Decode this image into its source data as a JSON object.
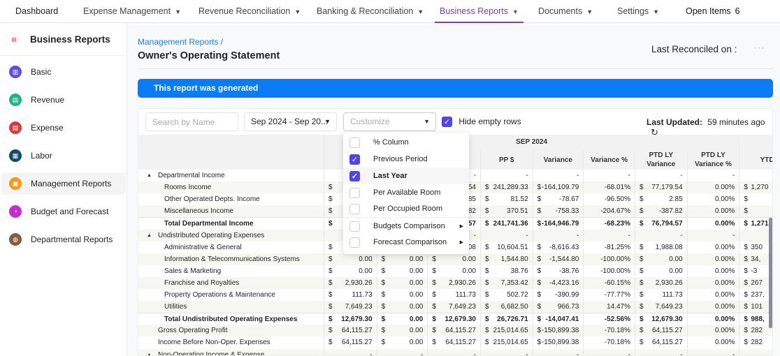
{
  "nav": {
    "items": [
      {
        "label": "Dashboard",
        "caret": false
      },
      {
        "label": "Expense Management",
        "caret": true
      },
      {
        "label": "Revenue Reconciliation",
        "caret": true
      },
      {
        "label": "Banking & Reconciliation",
        "caret": true
      },
      {
        "label": "Business Reports",
        "caret": true,
        "active": true
      },
      {
        "label": "Documents",
        "caret": true
      },
      {
        "label": "Settings",
        "caret": true
      }
    ],
    "open_items_label": "Open Items",
    "open_items_count": "6",
    "accent": "#7a3fb0"
  },
  "sidebar": {
    "title": "Business Reports",
    "items": [
      {
        "label": "Basic",
        "color": "#5b4ee8",
        "icon": "chart-icon"
      },
      {
        "label": "Revenue",
        "color": "#1fb58a",
        "icon": "revenue-icon"
      },
      {
        "label": "Expense",
        "color": "#d63b3b",
        "icon": "expense-icon"
      },
      {
        "label": "Labor",
        "color": "#0f4c6e",
        "icon": "labor-icon"
      },
      {
        "label": "Management Reports",
        "color": "#f29a17",
        "icon": "report-icon",
        "active": true
      },
      {
        "label": "Budget and Forecast",
        "color": "#c52ec9",
        "icon": "pie-chart-icon"
      },
      {
        "label": "Departmental Reports",
        "color": "#8a5a3c",
        "icon": "department-icon"
      }
    ]
  },
  "page": {
    "breadcrumb": "Management Reports /",
    "title": "Owner's Operating Statement",
    "last_reconciled": "Last Reconciled on :",
    "more": "···",
    "banner": "This report was generated",
    "banner_color": "#0a7cf5"
  },
  "toolbar": {
    "search_placeholder": "Search by Name",
    "period": "Sep 2024 - Sep 20...",
    "customize_placeholder": "Customize",
    "hide_empty_label": "Hide empty rows",
    "hide_empty_checked": true,
    "last_updated_label": "Last Updated:",
    "last_updated_value": "59 minutes ago"
  },
  "customize_menu": [
    {
      "label": "% Column",
      "checked": false
    },
    {
      "label": "Previous Period",
      "checked": true
    },
    {
      "label": "Last Year",
      "checked": true,
      "highlighted": true
    },
    {
      "label": "Per Available Room",
      "checked": false
    },
    {
      "label": "Per Occupied Room",
      "checked": false
    },
    {
      "label": "Budgets Comparison",
      "checked": false,
      "submenu": true
    },
    {
      "label": "Forecast Comparison",
      "checked": false,
      "submenu": true
    }
  ],
  "table": {
    "group_header": "SEP 2024",
    "columns": [
      "",
      "",
      "",
      "PP $",
      "Variance",
      "Variance %",
      "PTD LY Variance",
      "PTD LY Variance %",
      "YTD"
    ],
    "rows": [
      {
        "label": "Departmental Income",
        "type": "section",
        "cells": [
          "-",
          "-",
          "-",
          "-",
          "-",
          "-",
          "-",
          "-",
          ""
        ]
      },
      {
        "label": "Rooms Income",
        "cells": [
          "",
          "",
          "54",
          "241,289.33",
          "-164,109.79",
          "-68.01%",
          "77,179.54",
          "0.00%",
          "1,270"
        ]
      },
      {
        "label": "Other Operated Depts. Income",
        "cells": [
          "",
          "",
          "85",
          "81.52",
          "-78.67",
          "-96.50%",
          "2.85",
          "0.00%",
          ""
        ]
      },
      {
        "label": "Miscellaneous Income",
        "cells": [
          "",
          "",
          "82",
          "370.51",
          "-758.33",
          "-204.67%",
          "-387.82",
          "0.00%",
          ""
        ]
      },
      {
        "label": "Total Departmental Income",
        "type": "total",
        "cells": [
          "",
          "",
          "57",
          "241,741.36",
          "-164,946.79",
          "-68.23%",
          "76,794.57",
          "0.00%",
          "1,271,"
        ]
      },
      {
        "label": "Undistributed Operating Expenses",
        "type": "section",
        "cells": [
          "-",
          "-",
          "-",
          "-",
          "-",
          "-",
          "-",
          "-",
          ""
        ]
      },
      {
        "label": "Administrative & General",
        "cells": [
          "",
          "",
          "08",
          "10,604.51",
          "-8,616.43",
          "-81.25%",
          "1,988.08",
          "0.00%",
          "350"
        ]
      },
      {
        "label": "Information & Telecommunications Systems",
        "cells": [
          "0.00",
          "0.00",
          "0.00",
          "1,544.80",
          "-1,544.80",
          "-100.00%",
          "0.00",
          "0.00%",
          "34,"
        ]
      },
      {
        "label": "Sales & Marketing",
        "cells": [
          "0.00",
          "0.00",
          "0.00",
          "38.76",
          "-38.76",
          "-100.00%",
          "0.00",
          "0.00%",
          "-3"
        ]
      },
      {
        "label": "Franchise and Royalties",
        "cells": [
          "2,930.26",
          "0.00",
          "2,930.26",
          "7,353.42",
          "-4,423.16",
          "-60.15%",
          "2,930.26",
          "0.00%",
          "267"
        ]
      },
      {
        "label": "Property Operations & Maintenance",
        "cells": [
          "111.73",
          "0.00",
          "111.73",
          "502.72",
          "-390.99",
          "-77.77%",
          "111.73",
          "0.00%",
          "237,"
        ]
      },
      {
        "label": "Utilities",
        "cells": [
          "7,649.23",
          "0.00",
          "7,649.23",
          "6,682.50",
          "966.73",
          "14.47%",
          "7,649.23",
          "0.00%",
          "101"
        ]
      },
      {
        "label": "Total Undistributed Operating Expenses",
        "type": "total",
        "cells": [
          "12,679.30",
          "0.00",
          "12,679.30",
          "26,726.71",
          "-14,047.41",
          "-52.56%",
          "12,679.30",
          "0.00%",
          "988,"
        ]
      },
      {
        "label": "Gross Operating Profit",
        "type": "summary",
        "cells": [
          "64,115.27",
          "0.00",
          "64,115.27",
          "215,014.65",
          "-150,899.38",
          "-70.18%",
          "64,115.27",
          "0.00%",
          "282"
        ]
      },
      {
        "label": "Income Before Non-Oper. Expenses",
        "type": "summary",
        "cells": [
          "64,115.27",
          "0.00",
          "64,115.27",
          "215,014.65",
          "-150,899.38",
          "-70.18%",
          "64,115.27",
          "0.00%",
          "282"
        ]
      },
      {
        "label": "Non-Operating Income & Expense",
        "type": "section",
        "cells": [
          "-",
          "-",
          "-",
          "-",
          "-",
          "-",
          "-",
          "-",
          ""
        ]
      }
    ]
  }
}
